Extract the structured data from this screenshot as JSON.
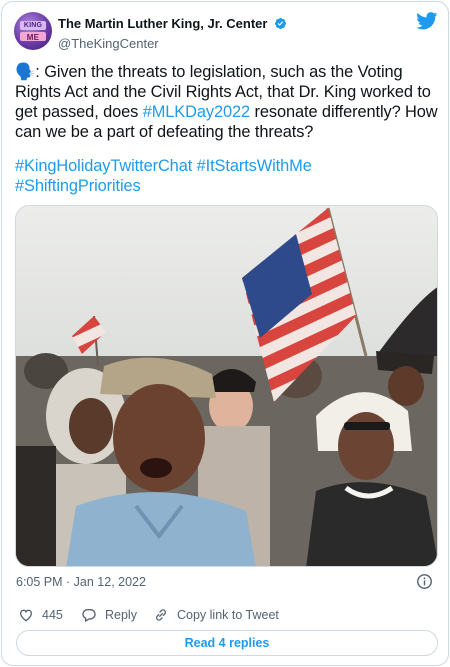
{
  "author": {
    "display_name": "The Martin Luther King, Jr. Center",
    "handle": "@TheKingCenter",
    "avatar_text_line1": "KING",
    "avatar_text_line2": "ME",
    "verified": true
  },
  "tweet": {
    "text_prefix": "🗣️: Given the threats to legislation, such as the Voting Rights Act and the Civil Rights Act, that Dr. King worked to get passed, does ",
    "text_link": "#MLKDay2022",
    "text_suffix": " resonate differently? How can we be a part of defeating the threats?",
    "hashtags": "#KingHolidayTwitterChat #ItStartsWithMe #ShiftingPriorities",
    "timestamp": "6:05 PM · Jan 12, 2022"
  },
  "actions": {
    "like_count": "445",
    "reply_label": "Reply",
    "copy_label": "Copy link to Tweet",
    "read_replies_label": "Read 4 replies"
  },
  "colors": {
    "accent": "#1d9bf0",
    "text": "#0f1419",
    "muted": "#536471",
    "border": "#cfd9de"
  },
  "icons": [
    "verified-badge-icon",
    "twitter-bird-icon",
    "info-icon",
    "heart-icon",
    "reply-bubble-icon",
    "copy-link-icon"
  ]
}
